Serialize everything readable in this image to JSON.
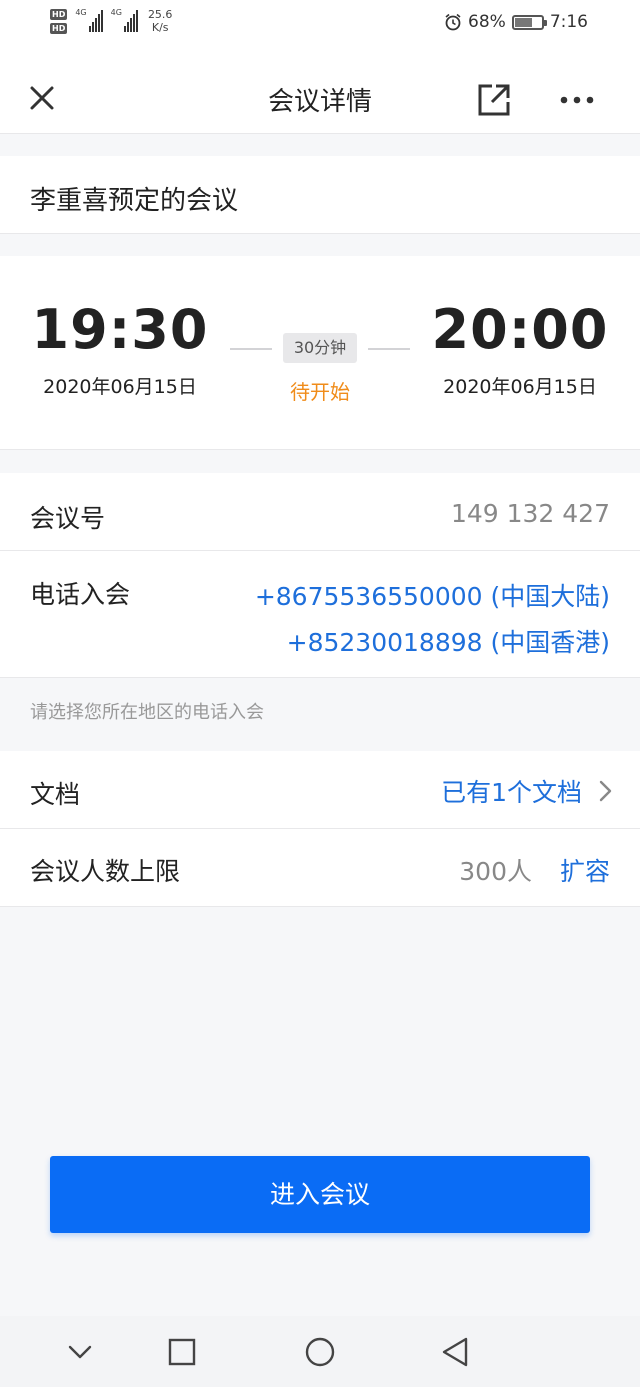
{
  "status_bar": {
    "hd1": "HD",
    "hd2": "HD",
    "net1": "4G",
    "net2": "4G",
    "speed_value": "25.6",
    "speed_unit": "K/s",
    "battery_percent": "68%",
    "battery_level": 0.68,
    "time": "7:16"
  },
  "header": {
    "title": "会议详情",
    "icons": [
      "close-icon",
      "share-icon",
      "more-icon"
    ]
  },
  "meeting": {
    "name": "李重喜预定的会议",
    "start_time": "19:30",
    "start_date": "2020年06月15日",
    "end_time": "20:00",
    "end_date": "2020年06月15日",
    "duration": "30分钟",
    "status": "待开始",
    "status_color": "#f08c1a"
  },
  "info": {
    "meeting_id_label": "会议号",
    "meeting_id": "149 132 427",
    "phone_label": "电话入会",
    "phone_numbers": [
      "+8675536550000 (中国大陆)",
      "+85230018898 (中国香港)"
    ],
    "phone_hint": "请选择您所在地区的电话入会"
  },
  "docs": {
    "label": "文档",
    "value": "已有1个文档",
    "limit_label": "会议人数上限",
    "limit_value": "300人",
    "expand": "扩容"
  },
  "actions": {
    "enter_meeting": "进入会议",
    "accent_color": "#0a6cf5"
  },
  "navbar": {
    "icons": [
      "back-chevron-icon",
      "recent-apps-icon",
      "home-icon",
      "back-icon"
    ]
  }
}
